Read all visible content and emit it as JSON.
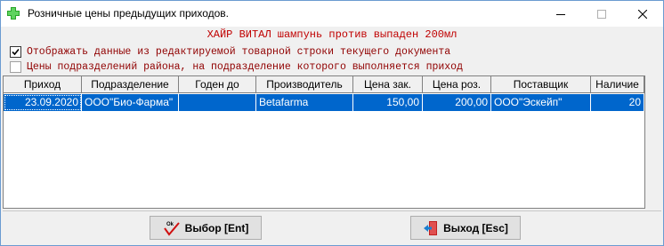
{
  "window": {
    "title": "Розничные цены предыдущих приходов.",
    "controls": {
      "minimize": "minimize",
      "maximize": "maximize",
      "close": "close"
    }
  },
  "product_name": "ХАЙР ВИТАЛ шампунь против выпаден 200мл",
  "options": [
    {
      "label": "Отображать данные из редактируемой товарной строки текущего документа",
      "checked": true
    },
    {
      "label": "Цены подразделений района, на подразделение которого выполняется приход",
      "checked": false
    }
  ],
  "table": {
    "columns": [
      "Приход",
      "Подразделение",
      "Годен до",
      "Производитель",
      "Цена зак.",
      "Цена роз.",
      "Поставщик",
      "Наличие"
    ],
    "rows": [
      [
        "23.09.2020",
        "ООО\"Био-Фарма\"",
        "",
        "Betafarma",
        "150,00",
        "200,00",
        "ООО\"Эскейп\"",
        "20"
      ]
    ]
  },
  "buttons": {
    "select": "Выбор [Ent]",
    "exit": "Выход [Esc]"
  },
  "colors": {
    "selection": "#0066cc",
    "product_name": "#c00000",
    "option_text": "#900000"
  },
  "icons": {
    "app": "green-cross-icon",
    "select": "ok-checkmark-icon",
    "exit": "exit-door-icon"
  }
}
